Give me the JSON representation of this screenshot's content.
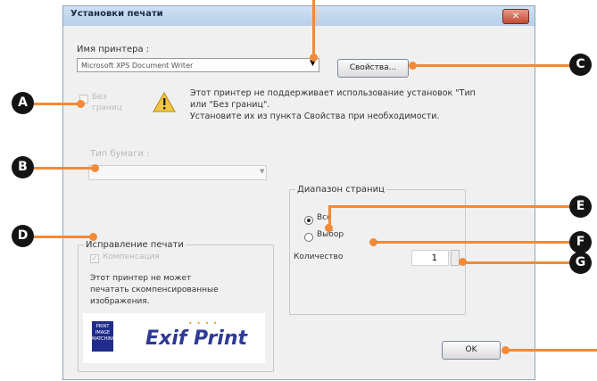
{
  "dialog": {
    "title": "Установки печати",
    "close_symbol": "✕",
    "printer_label": "Имя принтера :",
    "printer_value": "Microsoft XPS Document Writer",
    "properties_button": "Свойства...",
    "borderless_label": "Без\nграниц",
    "warning_message": "Этот принтер не поддерживает использование установок \"Тип\nили \"Без границ\".\nУстановите их из пункта Свойства при необходимости.",
    "paper_type_label": "Тип бумаги :",
    "page_range": {
      "legend": "Диапазон страниц",
      "all_label": "Все",
      "selection_label": "Выбор",
      "selected": "all"
    },
    "quantity_label": "Количество",
    "quantity_value": "1",
    "correction": {
      "legend": "Исправление печати",
      "compensation_label": "Компенсация",
      "compensation_checked": true,
      "note": "Этот принтер не может\nпечатать скомпенсированные\nизображения."
    },
    "exif_logo": {
      "badge_text": "PRINT\nIMAGE\nMATCHING",
      "text": "Exif Print"
    },
    "ok_button": "OK"
  },
  "callouts": {
    "A": "A",
    "B": "B",
    "C": "C",
    "D": "D",
    "E": "E",
    "F": "F",
    "G": "G"
  },
  "colors": {
    "callout_line": "#f28a37",
    "badge": "#141414",
    "dialog_bg": "#f0f0f0"
  },
  "icons": [
    "warning-icon",
    "dropdown-arrow-icon",
    "close-icon",
    "spinner-icon"
  ]
}
